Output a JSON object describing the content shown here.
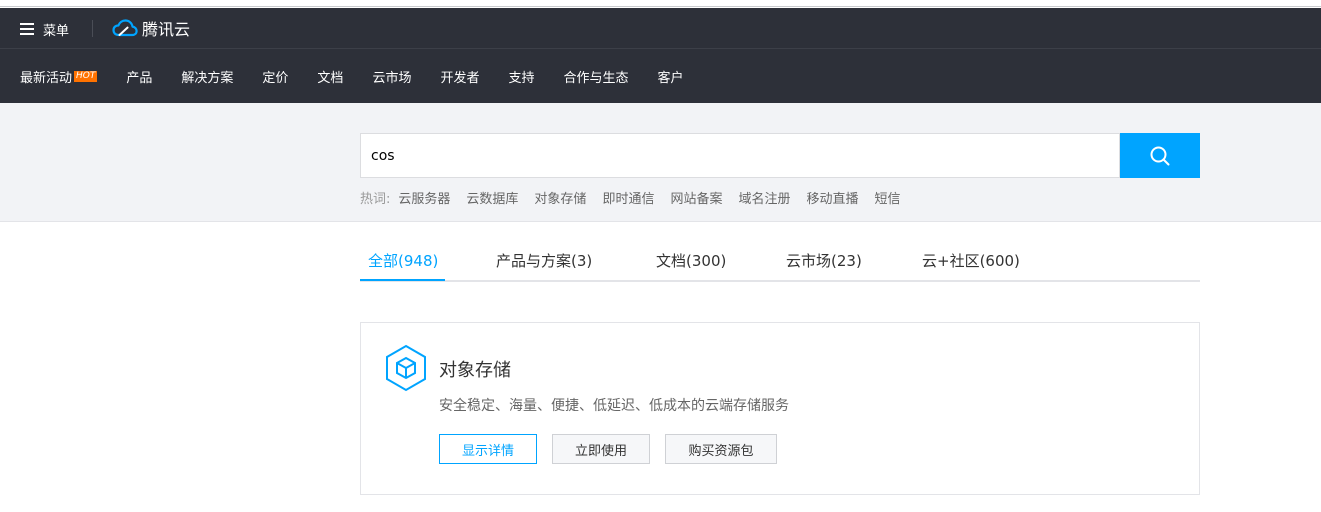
{
  "header": {
    "menu_label": "菜单",
    "logo_text": "腾讯云",
    "nav": [
      {
        "label": "最新活动",
        "badge": "HOT"
      },
      {
        "label": "产品"
      },
      {
        "label": "解决方案"
      },
      {
        "label": "定价"
      },
      {
        "label": "文档"
      },
      {
        "label": "云市场"
      },
      {
        "label": "开发者"
      },
      {
        "label": "支持"
      },
      {
        "label": "合作与生态"
      },
      {
        "label": "客户"
      }
    ]
  },
  "search": {
    "value": "cos",
    "hot_label": "热词:",
    "hotwords": [
      "云服务器",
      "云数据库",
      "对象存储",
      "即时通信",
      "网站备案",
      "域名注册",
      "移动直播",
      "短信"
    ]
  },
  "tabs": [
    {
      "label": "全部(948)",
      "active": true
    },
    {
      "label": "产品与方案(3)"
    },
    {
      "label": "文档(300)"
    },
    {
      "label": "云市场(23)"
    },
    {
      "label": "云+社区(600)"
    }
  ],
  "result": {
    "icon": "cube-hexagon-icon",
    "title": "对象存储",
    "description": "安全稳定、海量、便捷、低延迟、低成本的云端存储服务",
    "buttons": [
      "显示详情",
      "立即使用",
      "购买资源包"
    ]
  },
  "colors": {
    "header_bg": "#2d3039",
    "accent": "#00a4ff",
    "hot_badge": "#ff7200",
    "search_band_bg": "#f2f3f6"
  }
}
